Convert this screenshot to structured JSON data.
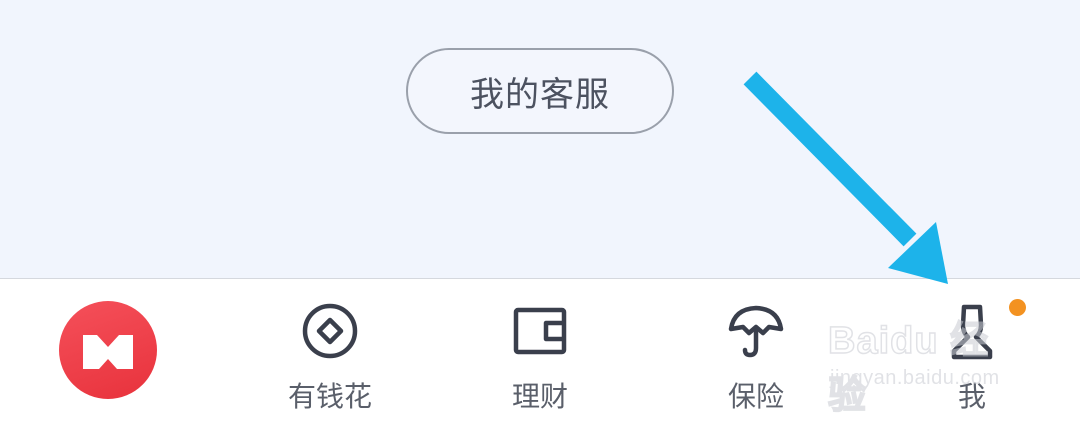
{
  "page": {
    "service_button_label": "我的客服"
  },
  "tab_bar": {
    "items": [
      {
        "id": "home",
        "label": "",
        "icon": "brand-book-logo-icon"
      },
      {
        "id": "borrow",
        "label": "有钱花",
        "icon": "coin-icon"
      },
      {
        "id": "finance",
        "label": "理财",
        "icon": "wallet-icon"
      },
      {
        "id": "insurance",
        "label": "保险",
        "icon": "umbrella-icon"
      },
      {
        "id": "me",
        "label": "我",
        "icon": "person-icon",
        "notification_dot": true
      }
    ]
  },
  "overlay": {
    "arrow_icon": "pointer-arrow-icon",
    "arrow_color": "#1db3ea"
  },
  "watermark": {
    "brand": "Baidu 经验",
    "url": "jingyan.baidu.com"
  },
  "colors": {
    "background": "#f1f5fd",
    "tab_bar_bg": "#ffffff",
    "logo_red": "#ee3d46",
    "icon_dark": "#3a3f4c",
    "badge_orange": "#f39221"
  }
}
